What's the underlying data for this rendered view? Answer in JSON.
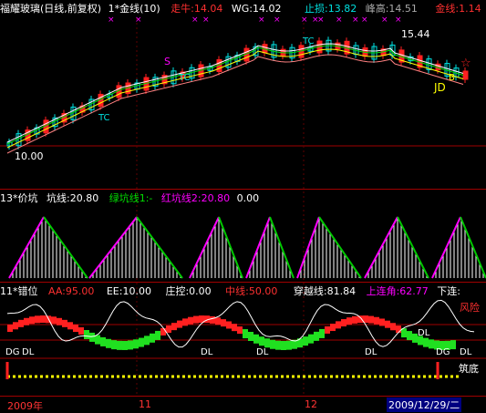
{
  "colors": {
    "up": "#ff2020",
    "down": "#00e0e0",
    "grid": "#a00000",
    "yellow": "#ffff00",
    "magenta": "#ff00ff",
    "green": "#00c800",
    "white": "#ffffff"
  },
  "main": {
    "stock_name": "福耀玻璃(日线,前复权)",
    "indicator": "1*金线(10)",
    "zouniu_label": "走牛:14.04",
    "wg_label": "WG:14.02",
    "zhisun_label": "止损:13.82",
    "fenggao_label": "峰高:14.51",
    "jinxian_label": "金线:1.14",
    "price_high_tag": "15.44",
    "price_low_tag": "10.00",
    "marker_s": "S",
    "marker_tc1": "TC",
    "marker_tc2": "TC",
    "marker_tc3": "TC",
    "marker_jd": "JD",
    "marker_b": "B"
  },
  "panel2": {
    "indicator": "13*价坑",
    "kengxian": "坑线:20.80",
    "lvkeng": "绿坑线1:-",
    "hongkeng": "红坑线2:20.80",
    "zero": "0.00"
  },
  "panel3": {
    "indicator": "11*错位",
    "aa": "AA:95.00",
    "ee": "EE:10.00",
    "zhuangkong": "庄控:0.00",
    "zhongxian": "中线:50.00",
    "chuanyue": "穿越线:81.84",
    "shanglian": "上连角:62.77",
    "xialian": "下连:",
    "fengxian": "风险",
    "zhudi": "筑底",
    "dg1": "DG",
    "dl1": "DL",
    "dl2": "DL",
    "dl3": "DL",
    "dl4": "DL",
    "dl5": "DL",
    "dg2": "DG",
    "dl6": "DL"
  },
  "axis": {
    "label_year": "2009年",
    "label_11": "11",
    "label_12": "12",
    "date_box": "2009/12/29/二"
  }
}
